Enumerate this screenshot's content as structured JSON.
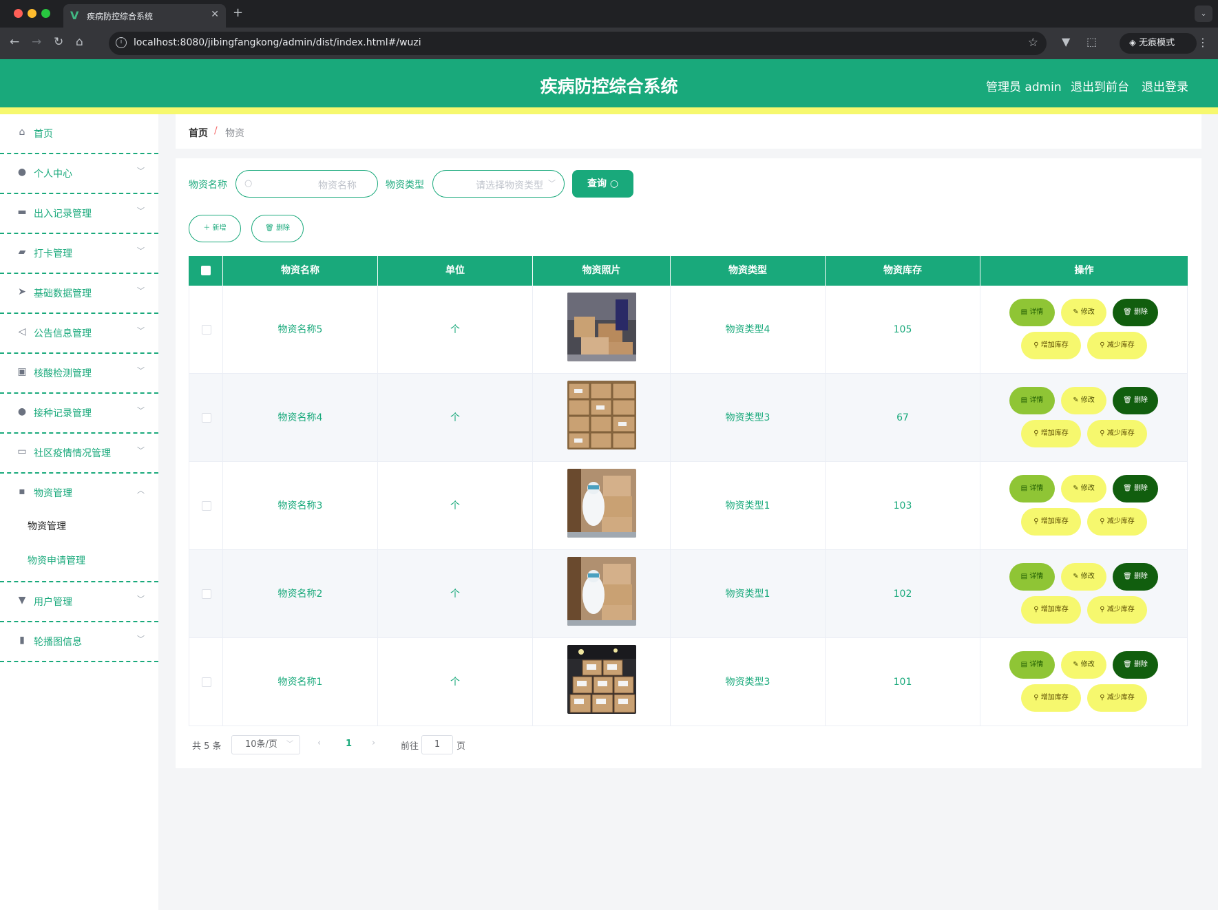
{
  "browser": {
    "tab_title": "疾病防控综合系统",
    "tab_logo": "V",
    "url": "localhost:8080/jibingfangkong/admin/dist/index.html#/wuzi",
    "incognito_label": "无痕模式"
  },
  "header": {
    "title": "疾病防控综合系统",
    "user_label": "管理员 admin",
    "front_link": "退出到前台",
    "logout_link": "退出登录",
    "accent_color": "#19a97b",
    "stripe_color": "#f6f86e"
  },
  "sidebar": {
    "items": [
      {
        "label": "首页",
        "icon": "home-icon",
        "expandable": false
      },
      {
        "label": "个人中心",
        "icon": "user-icon",
        "expandable": true
      },
      {
        "label": "出入记录管理",
        "icon": "inbox-icon",
        "expandable": true
      },
      {
        "label": "打卡管理",
        "icon": "wallet-icon",
        "expandable": true
      },
      {
        "label": "基础数据管理",
        "icon": "send-icon",
        "expandable": true
      },
      {
        "label": "公告信息管理",
        "icon": "navigation-icon",
        "expandable": true
      },
      {
        "label": "核酸检测管理",
        "icon": "briefcase-icon",
        "expandable": true
      },
      {
        "label": "接种记录管理",
        "icon": "user-icon",
        "expandable": true
      },
      {
        "label": "社区疫情情况管理",
        "icon": "chat-icon",
        "expandable": true
      },
      {
        "label": "物资管理",
        "icon": "message-icon",
        "expandable": true,
        "open": true
      },
      {
        "label": "用户管理",
        "icon": "trophy-icon",
        "expandable": true
      },
      {
        "label": "轮播图信息",
        "icon": "chart-icon",
        "expandable": true
      }
    ],
    "submenu": [
      {
        "label": "物资管理",
        "active": true
      },
      {
        "label": "物资申请管理",
        "active": false
      }
    ]
  },
  "breadcrumb": {
    "home": "首页",
    "separator": "/",
    "current": "物资"
  },
  "filters": {
    "name_label": "物资名称",
    "name_placeholder": "物资名称",
    "type_label": "物资类型",
    "type_placeholder": "请选择物资类型",
    "query_button": "查询"
  },
  "toolbar": {
    "add_button": "新增",
    "delete_button": "删除"
  },
  "table": {
    "columns": [
      "物资名称",
      "单位",
      "物资照片",
      "物资类型",
      "物资库存",
      "操作"
    ],
    "rows": [
      {
        "name": "物资名称5",
        "unit": "个",
        "type": "物资类型4",
        "stock": "105"
      },
      {
        "name": "物资名称4",
        "unit": "个",
        "type": "物资类型3",
        "stock": "67"
      },
      {
        "name": "物资名称3",
        "unit": "个",
        "type": "物资类型1",
        "stock": "103"
      },
      {
        "name": "物资名称2",
        "unit": "个",
        "type": "物资类型1",
        "stock": "102"
      },
      {
        "name": "物资名称1",
        "unit": "个",
        "type": "物资类型3",
        "stock": "101"
      }
    ],
    "actions": {
      "detail": "详情",
      "edit": "修改",
      "delete": "删除",
      "add_stock": "增加库存",
      "reduce_stock": "减少库存"
    }
  },
  "pagination": {
    "total_text": "共 5 条",
    "page_size": "10条/页",
    "current_page": "1",
    "goto_prefix": "前往",
    "goto_value": "1",
    "goto_suffix": "页"
  }
}
